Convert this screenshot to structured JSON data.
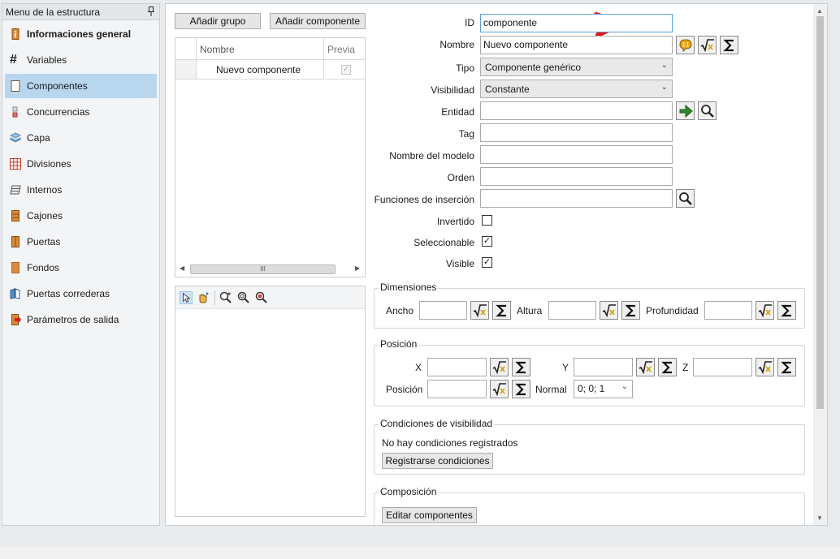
{
  "sidebar": {
    "title": "Menu de la estructura",
    "items": [
      {
        "label": "Informaciones general",
        "icon": "info-cabinet-icon"
      },
      {
        "label": "Variables",
        "icon": "hash-icon"
      },
      {
        "label": "Componentes",
        "icon": "component-icon"
      },
      {
        "label": "Concurrencias",
        "icon": "concurrency-icon"
      },
      {
        "label": "Capa",
        "icon": "layers-icon"
      },
      {
        "label": "Divisiones",
        "icon": "grid-divisions-icon"
      },
      {
        "label": "Internos",
        "icon": "shelves-icon"
      },
      {
        "label": "Cajones",
        "icon": "drawers-icon"
      },
      {
        "label": "Puertas",
        "icon": "door-icon"
      },
      {
        "label": "Fondos",
        "icon": "back-panel-icon"
      },
      {
        "label": "Puertas correderas",
        "icon": "sliding-door-icon"
      },
      {
        "label": "Parámetros de salida",
        "icon": "output-params-icon"
      }
    ]
  },
  "toolbar": {
    "add_group": "Añadir grupo",
    "add_component": "Añadir componente"
  },
  "grid": {
    "columns": [
      "Nombre",
      "Previa"
    ],
    "rows": [
      {
        "name": "Nuevo componente",
        "preview": true
      }
    ],
    "scroll_thumb": "III"
  },
  "form": {
    "id_label": "ID",
    "id_value": "componente",
    "nombre_label": "Nombre",
    "nombre_value": "Nuevo componente",
    "tipo_label": "Tipo",
    "tipo_value": "Componente genérico",
    "visibilidad_label": "Visibilidad",
    "visibilidad_value": "Constante",
    "entidad_label": "Entidad",
    "entidad_value": "",
    "tag_label": "Tag",
    "tag_value": "",
    "modelo_label": "Nombre del modelo",
    "modelo_value": "",
    "orden_label": "Orden",
    "orden_value": "",
    "funciones_label": "Funciones de inserción",
    "funciones_value": "",
    "invertido_label": "Invertido",
    "invertido": false,
    "seleccionable_label": "Seleccionable",
    "seleccionable": true,
    "visible_label": "Visible",
    "visible": true
  },
  "dimensiones": {
    "title": "Dimensiones",
    "ancho": "Ancho",
    "altura": "Altura",
    "profundidad": "Profundidad"
  },
  "posicion": {
    "title": "Posición",
    "x": "X",
    "y": "Y",
    "z": "Z",
    "posicion": "Posición",
    "normal": "Normal",
    "normal_value": "0; 0; 1"
  },
  "condiciones": {
    "title": "Condiciones de visibilidad",
    "empty": "No hay condiciones registrados",
    "button": "Registrarse condiciones"
  },
  "composicion": {
    "title": "Composición",
    "button": "Editar componentes"
  },
  "colors": {
    "accent": "#b9d6ef",
    "arrow": "#e8121a"
  }
}
